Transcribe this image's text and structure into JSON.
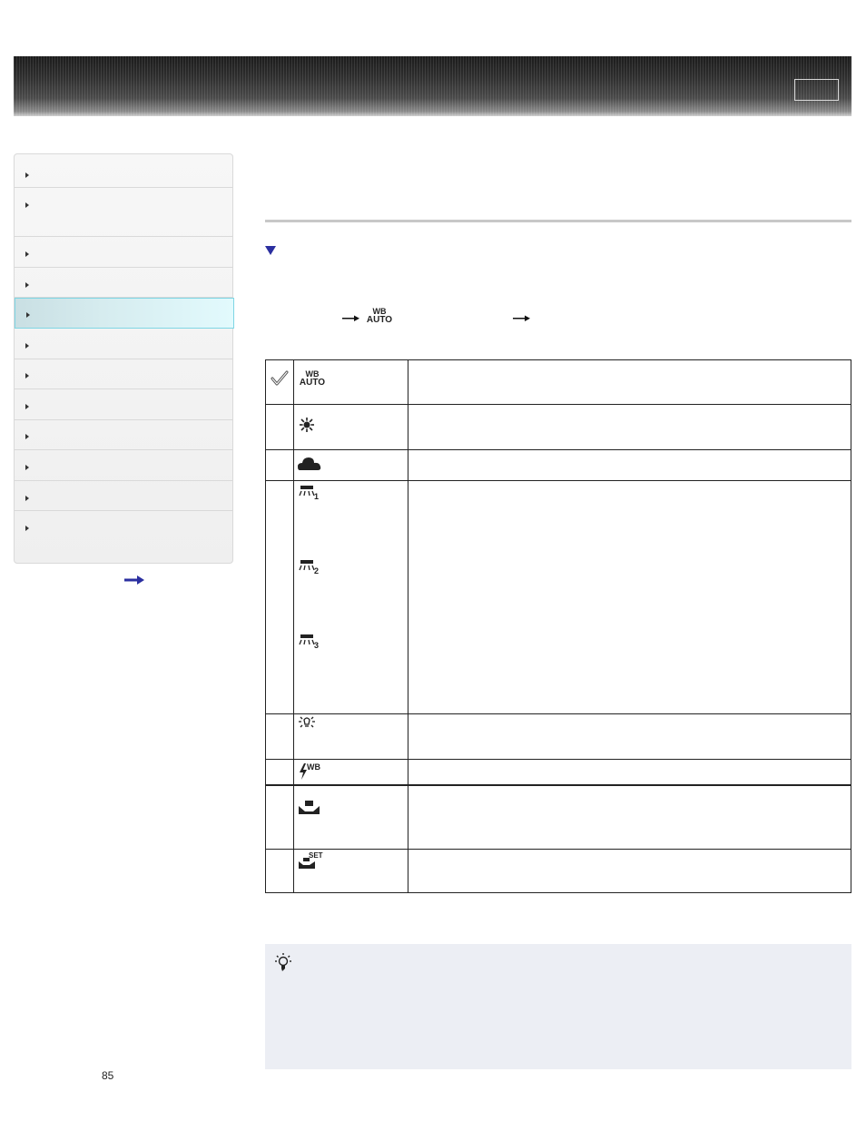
{
  "header": {
    "button_label": ""
  },
  "sidebar": {
    "items": [
      {
        "label": ""
      },
      {
        "label": ""
      },
      {
        "label": ""
      },
      {
        "label": ""
      },
      {
        "label": "",
        "active": true
      },
      {
        "label": ""
      },
      {
        "label": ""
      },
      {
        "label": ""
      },
      {
        "label": ""
      },
      {
        "label": ""
      },
      {
        "label": ""
      },
      {
        "label": ""
      }
    ],
    "more_icon": "arrow-right-icon"
  },
  "main": {
    "title": "",
    "menu_path": {
      "icon": "wb-auto-icon",
      "icon_text": {
        "top": "WB",
        "bottom": "AUTO"
      }
    },
    "table": {
      "rows": [
        {
          "checked": true,
          "icon": "wb-auto-icon",
          "icon_text": {
            "top": "WB",
            "bottom": "AUTO"
          },
          "description": ""
        },
        {
          "checked": false,
          "icon": "daylight-icon",
          "description": ""
        },
        {
          "checked": false,
          "icon": "cloudy-icon",
          "description": ""
        },
        {
          "checked": false,
          "icon": "fluorescent-icons",
          "icon_numbers": [
            "1",
            "2",
            "3"
          ],
          "description": ""
        },
        {
          "checked": false,
          "icon": "incandescent-icon",
          "description": ""
        },
        {
          "checked": false,
          "icon": "flash-wb-icon",
          "icon_text": {
            "top": "WB"
          },
          "description": ""
        },
        {
          "checked": false,
          "icon": "custom-wb-icon",
          "description": ""
        },
        {
          "checked": false,
          "icon": "custom-wb-set-icon",
          "icon_text": {
            "top": "SET"
          },
          "description": ""
        }
      ]
    },
    "tip": {
      "icon": "lightbulb-icon",
      "text": ""
    }
  },
  "footer": {
    "page_number": "85"
  },
  "colors": {
    "accent": "#2b2fa0",
    "active_nav": "#d6ecef",
    "tip_bg": "#eceef4"
  }
}
